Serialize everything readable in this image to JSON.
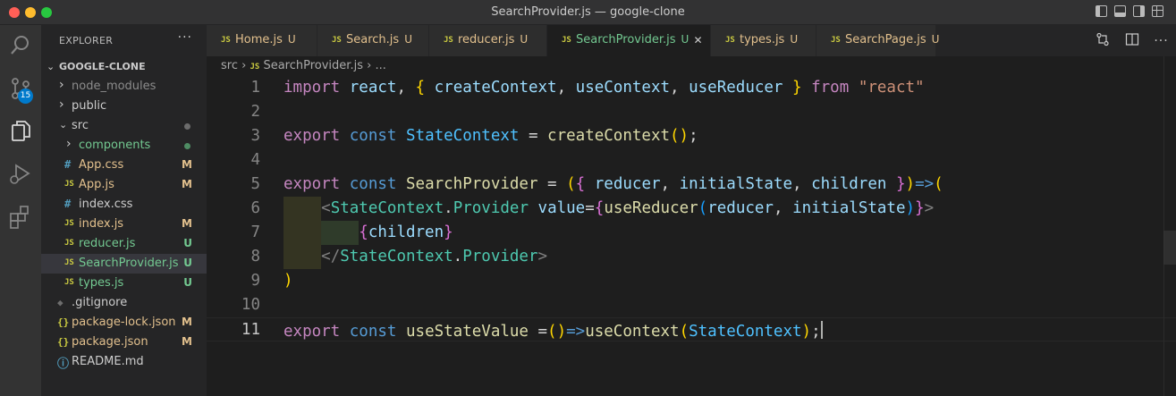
{
  "window": {
    "title": "SearchProvider.js — google-clone"
  },
  "activity": {
    "items": [
      "explorer-icon",
      "search-icon",
      "source-control-icon",
      "run-debug-icon",
      "extensions-icon"
    ],
    "scm_badge": "15"
  },
  "sidebar": {
    "header": "EXPLORER",
    "more": "···",
    "project": "GOOGLE-CLONE",
    "tree": [
      {
        "label": "node_modules",
        "kind": "folder",
        "open": false,
        "depth": 1,
        "color": "#8c8c8c",
        "badge": ""
      },
      {
        "label": "public",
        "kind": "folder",
        "open": false,
        "depth": 1,
        "color": "#cccccc",
        "badge": ""
      },
      {
        "label": "src",
        "kind": "folder",
        "open": true,
        "depth": 1,
        "color": "#cccccc",
        "badge": "dot-gray"
      },
      {
        "label": "components",
        "kind": "folder",
        "open": false,
        "depth": 2,
        "color": "#73c991",
        "badge": "dot-green"
      },
      {
        "label": "App.css",
        "kind": "css",
        "depth": 2,
        "color": "#e2c08d",
        "badge": "M"
      },
      {
        "label": "App.js",
        "kind": "js",
        "depth": 2,
        "color": "#e2c08d",
        "badge": "M"
      },
      {
        "label": "index.css",
        "kind": "css",
        "depth": 2,
        "color": "#cccccc",
        "badge": ""
      },
      {
        "label": "index.js",
        "kind": "js",
        "depth": 2,
        "color": "#e2c08d",
        "badge": "M"
      },
      {
        "label": "reducer.js",
        "kind": "js",
        "depth": 2,
        "color": "#73c991",
        "badge": "U"
      },
      {
        "label": "SearchProvider.js",
        "kind": "js",
        "depth": 2,
        "color": "#73c991",
        "badge": "U",
        "selected": true
      },
      {
        "label": "types.js",
        "kind": "js",
        "depth": 2,
        "color": "#73c991",
        "badge": "U"
      },
      {
        "label": ".gitignore",
        "kind": "git",
        "depth": 1,
        "color": "#cccccc",
        "badge": ""
      },
      {
        "label": "package-lock.json",
        "kind": "json",
        "depth": 1,
        "color": "#e2c08d",
        "badge": "M"
      },
      {
        "label": "package.json",
        "kind": "json",
        "depth": 1,
        "color": "#e2c08d",
        "badge": "M"
      },
      {
        "label": "README.md",
        "kind": "info",
        "depth": 1,
        "color": "#cccccc",
        "badge": ""
      }
    ]
  },
  "tabs": [
    {
      "label": "Home.js",
      "status": "U",
      "active": false,
      "color": "#e2c08d"
    },
    {
      "label": "Search.js",
      "status": "U",
      "active": false,
      "color": "#e2c08d"
    },
    {
      "label": "reducer.js",
      "status": "U",
      "active": false,
      "color": "#e2c08d"
    },
    {
      "label": "SearchProvider.js",
      "status": "U",
      "active": true,
      "color": "#73c991"
    },
    {
      "label": "types.js",
      "status": "U",
      "active": false,
      "color": "#e2c08d"
    },
    {
      "label": "SearchPage.js",
      "status": "U",
      "active": false,
      "color": "#e2c08d"
    }
  ],
  "tab_file_tag": "JS",
  "breadcrumb": {
    "folder": "src",
    "file": "SearchProvider.js",
    "tail": "..."
  },
  "editor": {
    "current_line": 11,
    "lines": [
      [
        [
          "kw",
          "import"
        ],
        [
          "txt",
          " "
        ],
        [
          "var",
          "react"
        ],
        [
          "txt",
          ", "
        ],
        [
          "b1",
          "{"
        ],
        [
          "txt",
          " "
        ],
        [
          "var",
          "createContext"
        ],
        [
          "txt",
          ", "
        ],
        [
          "var",
          "useContext"
        ],
        [
          "txt",
          ", "
        ],
        [
          "var",
          "useReducer"
        ],
        [
          "txt",
          " "
        ],
        [
          "b1",
          "}"
        ],
        [
          "txt",
          " "
        ],
        [
          "kw",
          "from"
        ],
        [
          "txt",
          " "
        ],
        [
          "str",
          "\"react\""
        ]
      ],
      [],
      [
        [
          "kw",
          "export"
        ],
        [
          "txt",
          " "
        ],
        [
          "kb",
          "const"
        ],
        [
          "txt",
          " "
        ],
        [
          "cls",
          "StateContext"
        ],
        [
          "txt",
          " = "
        ],
        [
          "fn",
          "createContext"
        ],
        [
          "b1",
          "()"
        ],
        [
          "txt",
          ";"
        ]
      ],
      [],
      [
        [
          "kw",
          "export"
        ],
        [
          "txt",
          " "
        ],
        [
          "kb",
          "const"
        ],
        [
          "txt",
          " "
        ],
        [
          "fn",
          "SearchProvider"
        ],
        [
          "txt",
          " = "
        ],
        [
          "b1",
          "("
        ],
        [
          "b2",
          "{"
        ],
        [
          "txt",
          " "
        ],
        [
          "var",
          "reducer"
        ],
        [
          "txt",
          ", "
        ],
        [
          "var",
          "initialState"
        ],
        [
          "txt",
          ", "
        ],
        [
          "var",
          "children"
        ],
        [
          "txt",
          " "
        ],
        [
          "b2",
          "}"
        ],
        [
          "b1",
          ")"
        ],
        [
          "kb",
          "=>"
        ],
        [
          "b1",
          "("
        ]
      ],
      [
        [
          "txt",
          "    "
        ],
        [
          "ang",
          "<"
        ],
        [
          "tag",
          "StateContext"
        ],
        [
          "txt",
          "."
        ],
        [
          "tag",
          "Provider"
        ],
        [
          "txt",
          " "
        ],
        [
          "var",
          "value"
        ],
        [
          "txt",
          "="
        ],
        [
          "b2",
          "{"
        ],
        [
          "fn",
          "useReducer"
        ],
        [
          "b3",
          "("
        ],
        [
          "var",
          "reducer"
        ],
        [
          "txt",
          ", "
        ],
        [
          "var",
          "initialState"
        ],
        [
          "b3",
          ")"
        ],
        [
          "b2",
          "}"
        ],
        [
          "ang",
          ">"
        ]
      ],
      [
        [
          "txt",
          "        "
        ],
        [
          "b2",
          "{"
        ],
        [
          "var",
          "children"
        ],
        [
          "b2",
          "}"
        ]
      ],
      [
        [
          "txt",
          "    "
        ],
        [
          "ang",
          "</"
        ],
        [
          "tag",
          "StateContext"
        ],
        [
          "txt",
          "."
        ],
        [
          "tag",
          "Provider"
        ],
        [
          "ang",
          ">"
        ]
      ],
      [
        [
          "b1",
          ")"
        ]
      ],
      [],
      [
        [
          "kw",
          "export"
        ],
        [
          "txt",
          " "
        ],
        [
          "kb",
          "const"
        ],
        [
          "txt",
          " "
        ],
        [
          "fn",
          "useStateValue"
        ],
        [
          "txt",
          " ="
        ],
        [
          "b1",
          "()"
        ],
        [
          "kb",
          "=>"
        ],
        [
          "fn",
          "useContext"
        ],
        [
          "b1",
          "("
        ],
        [
          "cls",
          "StateContext"
        ],
        [
          "b1",
          ")"
        ],
        [
          "txt",
          ";"
        ]
      ]
    ]
  }
}
